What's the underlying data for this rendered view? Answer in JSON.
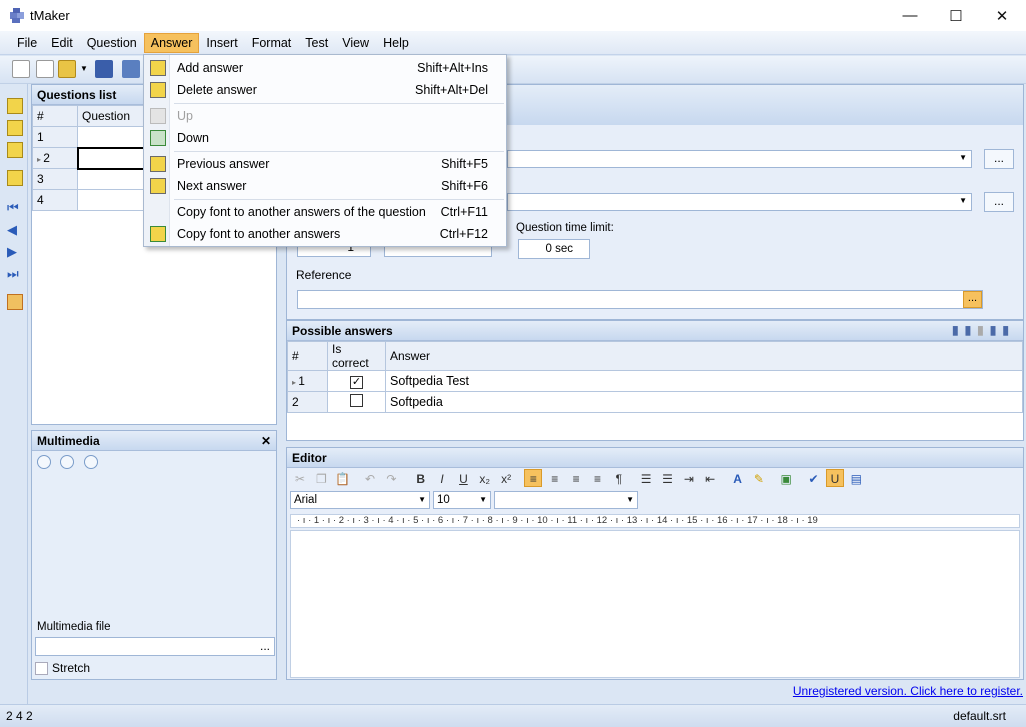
{
  "window": {
    "title": "tMaker",
    "minimize": "—",
    "maximize": "☐",
    "close": "✕"
  },
  "menu": {
    "items": [
      "File",
      "Edit",
      "Question",
      "Answer",
      "Insert",
      "Format",
      "Test",
      "View",
      "Help"
    ],
    "active": "Answer"
  },
  "answer_menu": {
    "items": [
      {
        "label": "Add answer",
        "shortcut": "Shift+Alt+Ins",
        "enabled": true,
        "icon": "add-answer-icon"
      },
      {
        "label": "Delete answer",
        "shortcut": "Shift+Alt+Del",
        "enabled": true,
        "icon": "delete-answer-icon"
      },
      {
        "label": "Up",
        "shortcut": "",
        "enabled": false,
        "icon": "move-up-icon"
      },
      {
        "label": "Down",
        "shortcut": "",
        "enabled": true,
        "icon": "move-down-icon"
      },
      {
        "label": "Previous answer",
        "shortcut": "Shift+F5",
        "enabled": true,
        "icon": "previous-answer-icon"
      },
      {
        "label": "Next answer",
        "shortcut": "Shift+F6",
        "enabled": true,
        "icon": "next-answer-icon"
      },
      {
        "label": "Copy font to another answers of the question",
        "shortcut": "Ctrl+F11",
        "enabled": true,
        "icon": ""
      },
      {
        "label": "Copy font to another answers",
        "shortcut": "Ctrl+F12",
        "enabled": true,
        "icon": "copy-font-icon"
      }
    ]
  },
  "questions_list": {
    "title": "Questions list",
    "columns": [
      "#",
      "Question"
    ],
    "rows": [
      {
        "num": "1"
      },
      {
        "num": "2"
      },
      {
        "num": "3"
      },
      {
        "num": "4"
      }
    ]
  },
  "multimedia": {
    "title": "Multimedia",
    "close": "✕",
    "file_label": "Multimedia file",
    "file_button": "...",
    "stretch_label": "Stretch"
  },
  "question_props": {
    "time_limit_label": "Question time limit:",
    "time_limit_value": "0 sec",
    "spin_value": "1",
    "reference_label": "Reference",
    "browse_button": "...",
    "reference_button": "..."
  },
  "possible_answers": {
    "title": "Possible answers",
    "columns": [
      "#",
      "Is correct",
      "Answer"
    ],
    "rows": [
      {
        "num": "1",
        "correct": true,
        "answer": "Softpedia Test"
      },
      {
        "num": "2",
        "correct": false,
        "answer": "Softpedia"
      }
    ]
  },
  "editor": {
    "title": "Editor",
    "font": "Arial",
    "size": "10",
    "ruler": "· ı · 1 · ı · 2 · ı · 3 · ı · 4 · ı · 5 · ı · 6 · ı · 7 · ı · 8 · ı · 9 · ı · 10 · ı · 11 · ı · 12 · ı · 13 · ı · 14 · ı · 15 · ı · 16 · ı · 17 · ı · 18 · ı · 19"
  },
  "register_link": "Unregistered version. Click here to register.",
  "status": {
    "left": "2  4  2",
    "right": "default.srt"
  },
  "colors": {
    "menu_highlight": "#f6c15e",
    "panel_header": "#c7d8ef",
    "accent_link": "#0000ee"
  }
}
